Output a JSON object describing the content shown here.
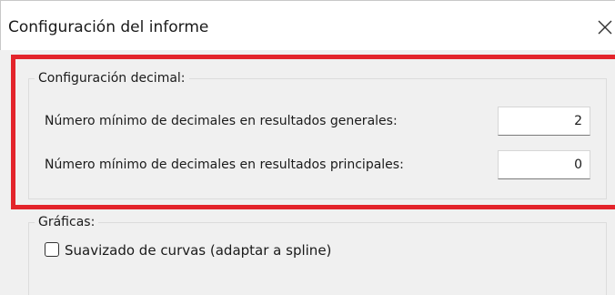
{
  "window": {
    "title": "Configuración del informe",
    "close_icon": "close-icon"
  },
  "decimal_settings": {
    "legend": "Configuración decimal:",
    "general_results_label": "Número mínimo de decimales en resultados generales:",
    "general_results_value": "2",
    "main_results_label": "Número mínimo de decimales en resultados principales:",
    "main_results_value": "0"
  },
  "charts": {
    "legend": "Gráficas:",
    "smoothing_label": "Suavizado de curvas (adaptar a spline)",
    "smoothing_checked": false
  },
  "colors": {
    "highlight": "#e3242b",
    "window_background": "#f0f0f0",
    "titlebar_background": "#ffffff"
  }
}
